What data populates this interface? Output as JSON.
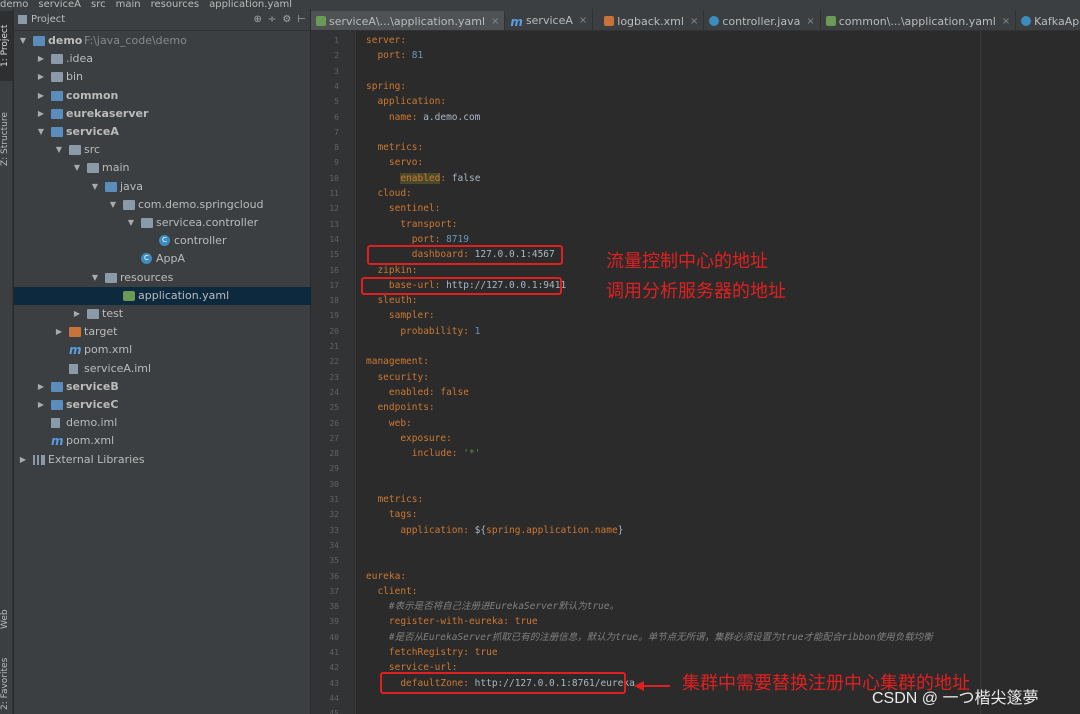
{
  "breadcrumb": [
    "demo",
    "serviceA",
    "src",
    "main",
    "resources",
    "application.yaml"
  ],
  "side_tabs": {
    "project": "1: Project",
    "structure": "Z: Structure",
    "web": "Web",
    "favorites": "2: Favorites"
  },
  "project_panel": {
    "title": "Project",
    "tool_icons": [
      "⊕",
      "÷",
      "⚙",
      "⊢"
    ],
    "tree": [
      {
        "label": "demo",
        "path": "F:\\java_code\\demo",
        "depth": 0,
        "expanded": true,
        "icon": "module-folder",
        "bold": true
      },
      {
        "label": ".idea",
        "depth": 1,
        "expanded": false,
        "icon": "folder"
      },
      {
        "label": "bin",
        "depth": 1,
        "expanded": false,
        "icon": "folder"
      },
      {
        "label": "common",
        "depth": 1,
        "expanded": false,
        "icon": "module-folder",
        "bold": true
      },
      {
        "label": "eurekaserver",
        "depth": 1,
        "expanded": false,
        "icon": "module-folder",
        "bold": true
      },
      {
        "label": "serviceA",
        "depth": 1,
        "expanded": true,
        "icon": "module-folder",
        "bold": true
      },
      {
        "label": "src",
        "depth": 2,
        "expanded": true,
        "icon": "folder"
      },
      {
        "label": "main",
        "depth": 3,
        "expanded": true,
        "icon": "folder"
      },
      {
        "label": "java",
        "depth": 4,
        "expanded": true,
        "icon": "source-folder"
      },
      {
        "label": "com.demo.springcloud",
        "depth": 5,
        "expanded": true,
        "icon": "package"
      },
      {
        "label": "servicea.controller",
        "depth": 6,
        "expanded": true,
        "icon": "package"
      },
      {
        "label": "controller",
        "depth": 7,
        "icon": "class"
      },
      {
        "label": "AppA",
        "depth": 6,
        "icon": "class"
      },
      {
        "label": "resources",
        "depth": 4,
        "expanded": true,
        "icon": "resource-folder"
      },
      {
        "label": "application.yaml",
        "depth": 5,
        "icon": "yaml",
        "selected": true
      },
      {
        "label": "test",
        "depth": 3,
        "expanded": false,
        "icon": "folder"
      },
      {
        "label": "target",
        "depth": 2,
        "expanded": false,
        "icon": "excluded-folder"
      },
      {
        "label": "pom.xml",
        "depth": 2,
        "icon": "maven"
      },
      {
        "label": "serviceA.iml",
        "depth": 2,
        "icon": "iml"
      },
      {
        "label": "serviceB",
        "depth": 1,
        "expanded": false,
        "icon": "module-folder",
        "bold": true
      },
      {
        "label": "serviceC",
        "depth": 1,
        "expanded": false,
        "icon": "module-folder",
        "bold": true
      },
      {
        "label": "demo.iml",
        "depth": 1,
        "icon": "iml"
      },
      {
        "label": "pom.xml",
        "depth": 1,
        "icon": "maven"
      },
      {
        "label": "External Libraries",
        "depth": 0,
        "expanded": false,
        "icon": "libraries"
      }
    ]
  },
  "editor_tabs": [
    {
      "label": "serviceA\\...\\application.yaml",
      "icon": "yaml",
      "active": true
    },
    {
      "label": "serviceA",
      "icon": "maven"
    },
    {
      "label": "logback.xml",
      "icon": "xml"
    },
    {
      "label": "controller.java",
      "icon": "class"
    },
    {
      "label": "common\\...\\application.yaml",
      "icon": "yaml"
    },
    {
      "label": "KafkaAppender.java",
      "icon": "class"
    }
  ],
  "code_lines": [
    [
      [
        "k",
        "server:"
      ]
    ],
    [
      [
        "k",
        "  port: "
      ],
      [
        "n",
        "81"
      ]
    ],
    [],
    [
      [
        "k",
        "spring:"
      ]
    ],
    [
      [
        "k",
        "  application:"
      ]
    ],
    [
      [
        "k",
        "    name: "
      ],
      [
        "v",
        "a.demo.com"
      ]
    ],
    [],
    [
      [
        "k",
        "  metrics:"
      ]
    ],
    [
      [
        "k",
        "    servo:"
      ]
    ],
    [
      [
        "k",
        "      "
      ],
      [
        "hl",
        "enabled"
      ],
      [
        "k",
        ": "
      ],
      [
        "v",
        "false"
      ]
    ],
    [
      [
        "k",
        "  cloud:"
      ]
    ],
    [
      [
        "k",
        "    sentinel:"
      ]
    ],
    [
      [
        "k",
        "      transport:"
      ]
    ],
    [
      [
        "k",
        "        port: "
      ],
      [
        "n",
        "8719"
      ]
    ],
    [
      [
        "k",
        "        dashboard: "
      ],
      [
        "v",
        "127.0.0.1:4567"
      ]
    ],
    [
      [
        "k",
        "  zipkin:"
      ]
    ],
    [
      [
        "k",
        "    base-url: "
      ],
      [
        "v",
        "http://127.0.0.1:9411"
      ]
    ],
    [
      [
        "k",
        "  sleuth:"
      ]
    ],
    [
      [
        "k",
        "    sampler:"
      ]
    ],
    [
      [
        "k",
        "      probability: "
      ],
      [
        "n",
        "1"
      ]
    ],
    [],
    [
      [
        "k",
        "management:"
      ]
    ],
    [
      [
        "k",
        "  security:"
      ]
    ],
    [
      [
        "k",
        "    enabled: "
      ],
      [
        "b",
        "false"
      ]
    ],
    [
      [
        "k",
        "  endpoints:"
      ]
    ],
    [
      [
        "k",
        "    web:"
      ]
    ],
    [
      [
        "k",
        "      exposure:"
      ]
    ],
    [
      [
        "k",
        "        include: "
      ],
      [
        "s",
        "'*'"
      ]
    ],
    [],
    [],
    [
      [
        "k",
        "  metrics:"
      ]
    ],
    [
      [
        "k",
        "    tags:"
      ]
    ],
    [
      [
        "k",
        "      application: "
      ],
      [
        "v",
        "${"
      ],
      [
        "k",
        "spring.application.name"
      ],
      [
        "v",
        "}"
      ]
    ],
    [],
    [],
    [
      [
        "k",
        "eureka:"
      ]
    ],
    [
      [
        "k",
        "  client:"
      ]
    ],
    [
      [
        "c",
        "    #表示是否将自己注册进EurekaServer默认为true。"
      ]
    ],
    [
      [
        "k",
        "    register-with-eureka: "
      ],
      [
        "b",
        "true"
      ]
    ],
    [
      [
        "c",
        "    #是否从EurekaServer抓取已有的注册信息，默认为true。单节点无所谓，集群必须设置为true才能配合ribbon使用负载均衡"
      ]
    ],
    [
      [
        "k",
        "    fetchRegistry: "
      ],
      [
        "b",
        "true"
      ]
    ],
    [
      [
        "k",
        "    service-url:"
      ]
    ],
    [
      [
        "k",
        "      defaultZone: "
      ],
      [
        "v",
        "http://127.0.0.1:8761/eureka"
      ]
    ],
    [],
    []
  ],
  "annotations": {
    "sentinel_note": "流量控制中心的地址",
    "zipkin_note": "调用分析服务器的地址",
    "eureka_note": "集群中需要替换注册中心集群的地址"
  },
  "watermark": "CSDN @ 一つ楷尖篴夢",
  "colors": {
    "annotation": "#e02020",
    "keyword": "#cc7832",
    "number": "#6897bb",
    "comment": "#808080",
    "selection": "#0d293e"
  }
}
